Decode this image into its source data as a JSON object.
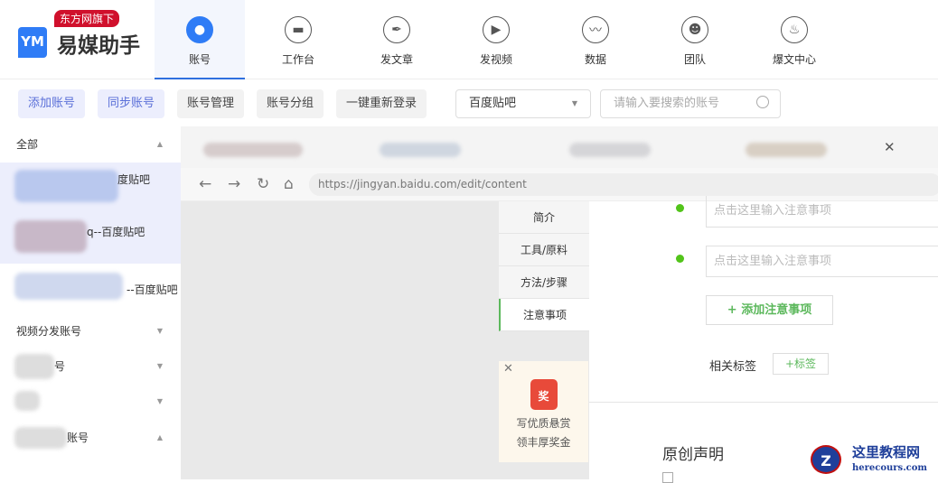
{
  "brand": {
    "badge": "东方网旗下",
    "name": "易媒助手",
    "logo_letters": "YM"
  },
  "nav": [
    {
      "label": "账号",
      "icon": "user-icon",
      "active": true
    },
    {
      "label": "工作台",
      "icon": "monitor-icon"
    },
    {
      "label": "发文章",
      "icon": "feather-icon"
    },
    {
      "label": "发视频",
      "icon": "play-icon"
    },
    {
      "label": "数据",
      "icon": "chart-icon"
    },
    {
      "label": "团队",
      "icon": "team-icon"
    },
    {
      "label": "爆文中心",
      "icon": "fire-icon"
    }
  ],
  "toolbar": {
    "add": "添加账号",
    "sync": "同步账号",
    "manage": "账号管理",
    "group": "账号分组",
    "relogin": "一键重新登录",
    "platform": "百度贴吧",
    "search_placeholder": "请输入要搜索的账号"
  },
  "sidebar": {
    "all": "全部",
    "accounts": [
      "度贴吧",
      "q--百度贴吧",
      "--百度贴吧"
    ],
    "video_group": "视频分发账号",
    "groups": [
      "号",
      "",
      "账号"
    ]
  },
  "browser": {
    "url": "https://jingyan.baidu.com/edit/content"
  },
  "editor": {
    "sections": [
      "简介",
      "工具/原料",
      "方法/步骤",
      "注意事项"
    ],
    "note_placeholder": "点击这里输入注意事项",
    "add_note": "+ 添加注意事项",
    "tags_label": "相关标签",
    "add_tag": "+标签",
    "original_title": "原创声明",
    "reward": {
      "icon_text": "奖",
      "line1": "写优质悬赏",
      "line2": "领丰厚奖金"
    }
  },
  "watermark": {
    "title": "这里教程网",
    "domain": "herecours.com"
  }
}
